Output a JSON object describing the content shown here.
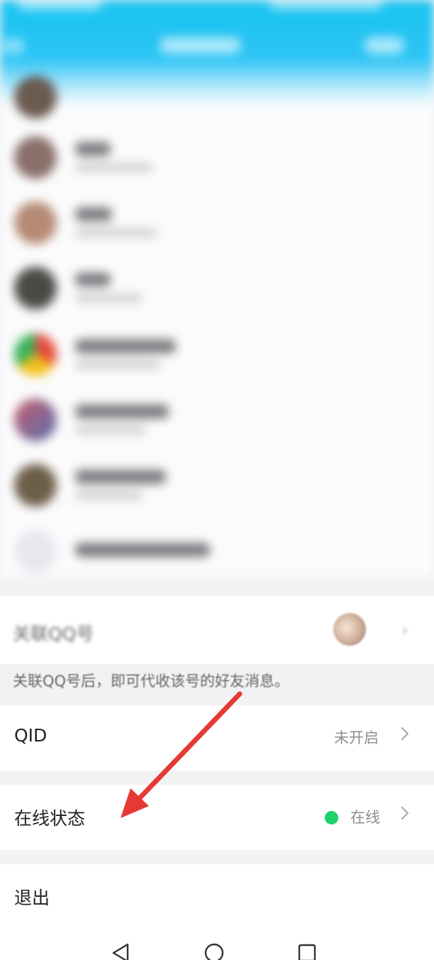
{
  "associate": {
    "label": "关联QQ号",
    "hint": "关联QQ号后，即可代收该号的好友消息。"
  },
  "settings": {
    "qid": {
      "label": "QID",
      "value": "未开启"
    },
    "online_status": {
      "label": "在线状态",
      "value": "在线",
      "dot_color": "#1ed168"
    },
    "logout": {
      "label": "退出"
    }
  },
  "colors": {
    "header_blue": "#12c3ef",
    "arrow_red": "#e53935",
    "online_green": "#1ed168"
  },
  "nav": {
    "back": "back-icon",
    "home": "home-icon",
    "recent": "recent-apps-icon"
  }
}
